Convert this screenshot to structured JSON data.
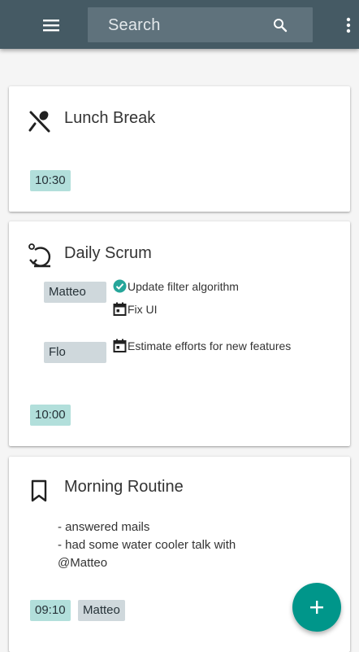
{
  "header": {
    "search_placeholder": "Search",
    "menu_icon": "hamburger-menu-icon",
    "search_icon": "search-icon",
    "more_icon": "more-vert-icon",
    "color": "#455a64"
  },
  "cards": [
    {
      "title": "Lunch Break",
      "icon": "utensils-icon",
      "time": "10:30"
    },
    {
      "title": "Daily Scrum",
      "icon": "restore-icon",
      "time": "10:00",
      "participants": [
        {
          "name": "Matteo",
          "tasks": [
            {
              "label": "Update filter algorithm",
              "icon": "check-circle-icon",
              "done": true
            },
            {
              "label": "Fix UI",
              "icon": "calendar-icon",
              "done": false
            }
          ]
        },
        {
          "name": "Flo",
          "tasks": [
            {
              "label": "Estimate efforts for new features",
              "icon": "calendar-icon",
              "done": false
            }
          ]
        }
      ]
    },
    {
      "title": "Morning Routine",
      "icon": "bookmark-icon",
      "time": "09:10",
      "person": "Matteo",
      "note_lines": [
        "- answered mails",
        "- had some water cooler talk with",
        "@Matteo"
      ]
    }
  ],
  "fab": {
    "icon": "add-icon",
    "color": "#00968a"
  },
  "colors": {
    "time_chip": "#b2dfdb",
    "person_chip": "#cfd8dc",
    "done": "#26a69a"
  }
}
